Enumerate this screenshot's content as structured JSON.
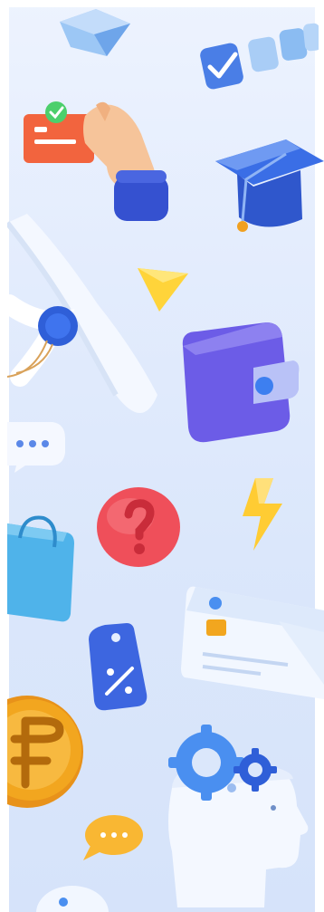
{
  "colors": {
    "background_top": "#edf3fe",
    "background_bottom": "#d6e3fa",
    "cube_blue": "#7ab4f0",
    "accent_blue": "#3f6fe0",
    "card_red": "#f2643e",
    "triangle_yellow": "#ffd43a",
    "wallet_purple": "#6c5ce7",
    "question_red": "#ef4f5a",
    "bolt_yellow": "#ffcc33",
    "bag_blue": "#4fb3ea",
    "coin_gold": "#f2a61f",
    "gear_blue": "#4a8ff0"
  },
  "decorations": [
    {
      "name": "cube-icon"
    },
    {
      "name": "checkbox-blocks-icon"
    },
    {
      "name": "hand-holding-card-icon"
    },
    {
      "name": "graduation-cap-icon"
    },
    {
      "name": "triangle-icon"
    },
    {
      "name": "diploma-scroll-icon"
    },
    {
      "name": "wallet-icon"
    },
    {
      "name": "chat-bubble-icon"
    },
    {
      "name": "question-mark-icon"
    },
    {
      "name": "lightning-bolt-icon"
    },
    {
      "name": "shopping-bag-icon"
    },
    {
      "name": "credit-card-icon"
    },
    {
      "name": "price-tag-icon"
    },
    {
      "name": "ruble-coin-icon"
    },
    {
      "name": "head-with-gears-icon"
    },
    {
      "name": "message-bubble-icon"
    }
  ]
}
